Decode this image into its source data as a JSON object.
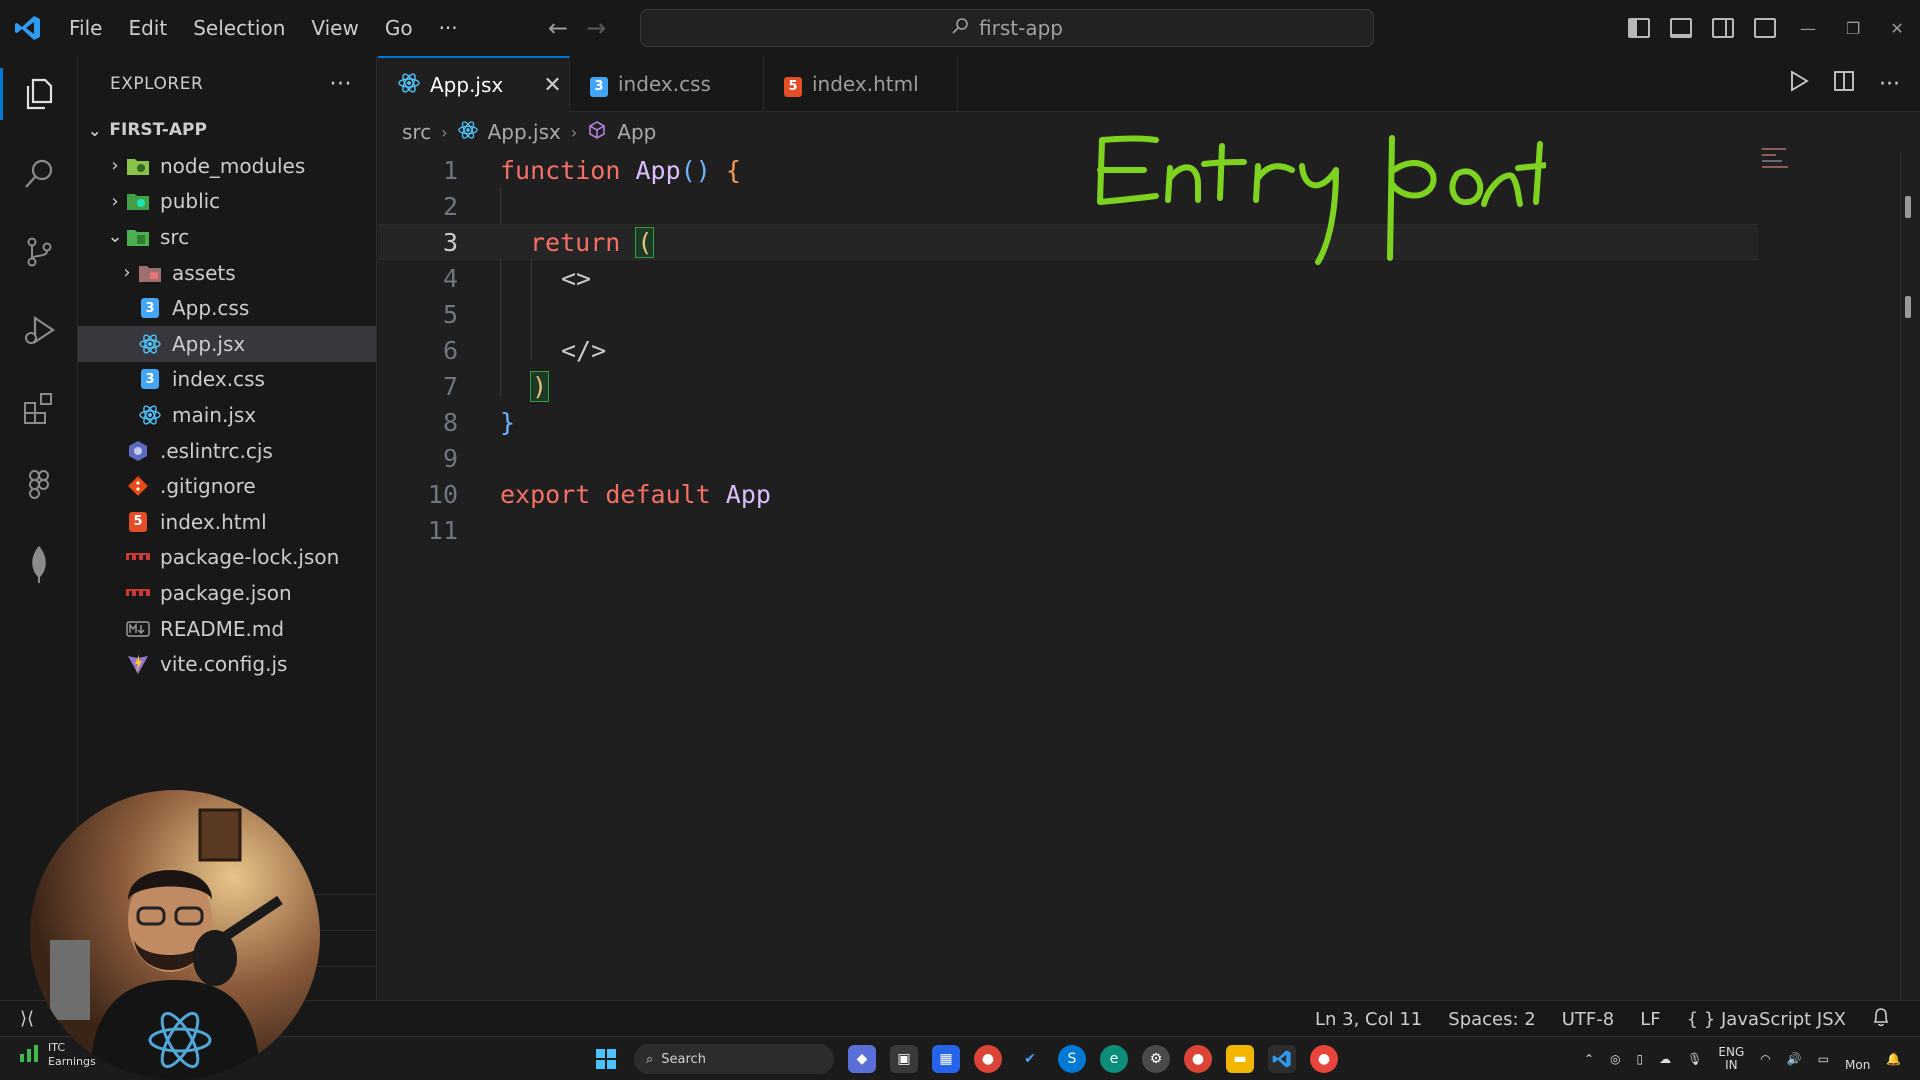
{
  "titlebar": {
    "menu": [
      "File",
      "Edit",
      "Selection",
      "View",
      "Go",
      "···"
    ],
    "command_center": "first-app"
  },
  "sidebar": {
    "title": "EXPLORER",
    "more": "···",
    "root": "FIRST-APP",
    "items": [
      {
        "label": "node_modules",
        "icon": "folder-node-icon"
      },
      {
        "label": "public",
        "icon": "folder-public-icon"
      },
      {
        "label": "src",
        "icon": "folder-src-icon"
      },
      {
        "label": "assets",
        "icon": "folder-assets-icon"
      },
      {
        "label": "App.css",
        "icon": "css-file-icon"
      },
      {
        "label": "App.jsx",
        "icon": "react-file-icon"
      },
      {
        "label": "index.css",
        "icon": "css-file-icon"
      },
      {
        "label": "main.jsx",
        "icon": "react-file-icon"
      },
      {
        "label": ".eslintrc.cjs",
        "icon": "eslint-file-icon"
      },
      {
        "label": ".gitignore",
        "icon": "git-file-icon"
      },
      {
        "label": "index.html",
        "icon": "html-file-icon"
      },
      {
        "label": "package-lock.json",
        "icon": "npm-file-icon"
      },
      {
        "label": "package.json",
        "icon": "npm-file-icon"
      },
      {
        "label": "README.md",
        "icon": "markdown-file-icon"
      },
      {
        "label": "vite.config.js",
        "icon": "vite-file-icon"
      }
    ],
    "selected": "App.jsx"
  },
  "tabs": [
    {
      "label": "App.jsx",
      "active": true
    },
    {
      "label": "index.css",
      "active": false
    },
    {
      "label": "index.html",
      "active": false
    }
  ],
  "breadcrumb": [
    "src",
    "App.jsx",
    "App"
  ],
  "editor": {
    "line_numbers": [
      "1",
      "2",
      "3",
      "4",
      "5",
      "6",
      "7",
      "8",
      "9",
      "10",
      "11"
    ],
    "current_line": 3,
    "code": {
      "l1_kw": "function",
      "l1_name": "App",
      "l1_parens": "()",
      "l1_brace": "{",
      "l3_kw": "return",
      "l3_paren": "(",
      "l4": "<>",
      "l6": "</>",
      "l7": ")",
      "l8": "}",
      "l10_kw1": "export",
      "l10_kw2": "default",
      "l10_name": "App"
    }
  },
  "annotation": {
    "handwritten": "Entry point",
    "color": "#7ed321"
  },
  "statusbar": {
    "position": "Ln 3, Col 11",
    "spaces": "Spaces: 2",
    "encoding": "UTF-8",
    "eol": "LF",
    "braces": "{ }",
    "language": "JavaScript JSX"
  },
  "taskbar": {
    "weather_ticker": "ITC",
    "weather_sub": "Earnings",
    "search": "Search",
    "lang_top": "ENG",
    "lang_bottom": "IN",
    "day": "Mon"
  },
  "colors": {
    "accent": "#0078d4",
    "keyword": "#f47067",
    "function": "#dcbdfb"
  }
}
